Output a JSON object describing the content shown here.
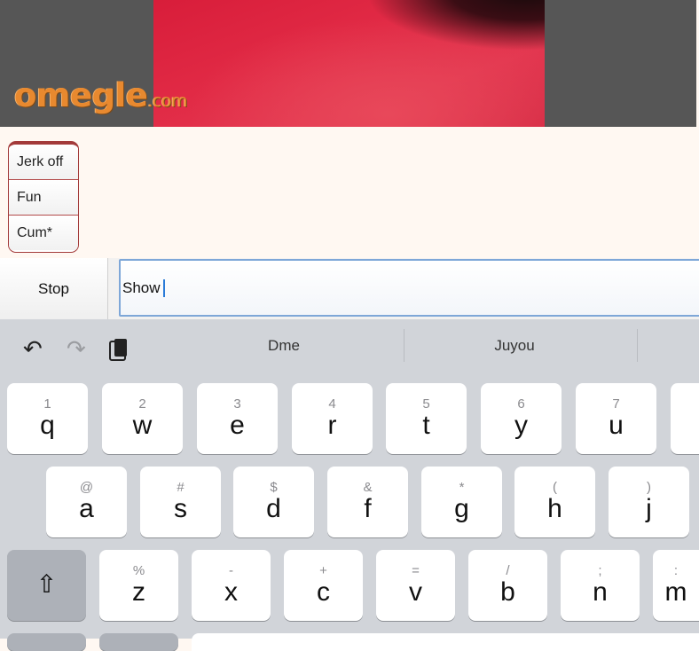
{
  "video": {
    "logo_main": "omegle",
    "logo_tld": ".com"
  },
  "interests": [
    "Jerk off",
    "Fun",
    "Cum*"
  ],
  "controls": {
    "stop_label": "Stop",
    "input_value": "Show"
  },
  "keyboard": {
    "suggestions": [
      "Dme",
      "Juyou"
    ],
    "tools": {
      "undo": "↶",
      "redo": "↷",
      "paste": "📋"
    },
    "row1": [
      {
        "sub": "1",
        "main": "q"
      },
      {
        "sub": "2",
        "main": "w"
      },
      {
        "sub": "3",
        "main": "e"
      },
      {
        "sub": "4",
        "main": "r"
      },
      {
        "sub": "5",
        "main": "t"
      },
      {
        "sub": "6",
        "main": "y"
      },
      {
        "sub": "7",
        "main": "u"
      }
    ],
    "row2": [
      {
        "sub": "@",
        "main": "a"
      },
      {
        "sub": "#",
        "main": "s"
      },
      {
        "sub": "$",
        "main": "d"
      },
      {
        "sub": "&",
        "main": "f"
      },
      {
        "sub": "*",
        "main": "g"
      },
      {
        "sub": "(",
        "main": "h"
      },
      {
        "sub": ")",
        "main": "j"
      }
    ],
    "row3": [
      {
        "sub": "%",
        "main": "z"
      },
      {
        "sub": "-",
        "main": "x"
      },
      {
        "sub": "+",
        "main": "c"
      },
      {
        "sub": "=",
        "main": "v"
      },
      {
        "sub": "/",
        "main": "b"
      },
      {
        "sub": ";",
        "main": "n"
      },
      {
        "sub": ":",
        "main": "m"
      }
    ],
    "shift_symbol": "⇧"
  }
}
